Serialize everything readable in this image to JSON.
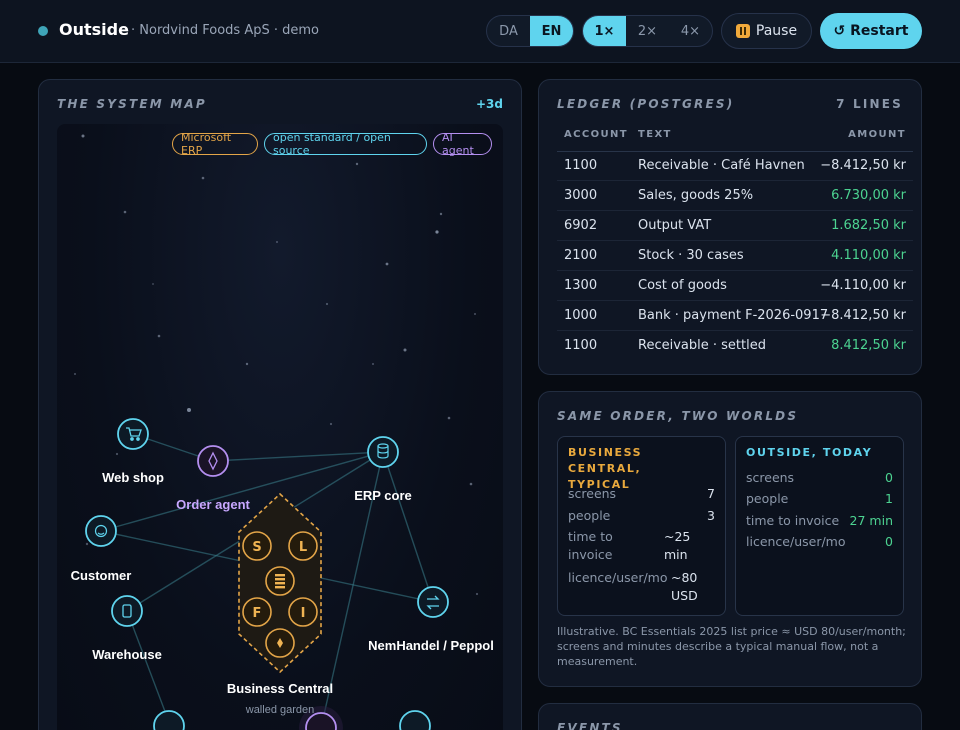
{
  "header": {
    "title": "Outside",
    "subtitle": "· Nordvind Foods ApS · demo",
    "lang_options": [
      "DA",
      "EN"
    ],
    "lang_selected": "EN",
    "speed_options": [
      "1×",
      "2×",
      "4×"
    ],
    "speed_selected": "1×",
    "pause_label": "Pause",
    "restart_label": "↺ Restart"
  },
  "map": {
    "title": "THE SYSTEM MAP",
    "badge": "+3d",
    "legend": {
      "microsoft": "Microsoft ERP",
      "open": "open standard / open source",
      "ai": "AI agent"
    },
    "nodes": {
      "webshop": "Web shop",
      "order_agent": "Order agent",
      "erp_core": "ERP core",
      "customer": "Customer",
      "warehouse": "Warehouse",
      "nemhandel": "NemHandel / Peppol",
      "bc": "Business Central",
      "bc_sub": "walled garden"
    },
    "hex_letters": [
      "S",
      "L",
      "F",
      "I"
    ]
  },
  "ledger": {
    "title": "LEDGER (POSTGRES)",
    "count": "7 LINES",
    "columns": [
      "ACCOUNT",
      "TEXT",
      "AMOUNT"
    ],
    "rows": [
      {
        "account": "1100",
        "text": "Receivable · Café Havnen",
        "amount": "−8.412,50 kr",
        "sign": "neg"
      },
      {
        "account": "3000",
        "text": "Sales, goods 25%",
        "amount": "6.730,00 kr",
        "sign": "pos"
      },
      {
        "account": "6902",
        "text": "Output VAT",
        "amount": "1.682,50 kr",
        "sign": "pos"
      },
      {
        "account": "2100",
        "text": "Stock · 30 cases",
        "amount": "4.110,00 kr",
        "sign": "pos"
      },
      {
        "account": "1300",
        "text": "Cost of goods",
        "amount": "−4.110,00 kr",
        "sign": "neg"
      },
      {
        "account": "1000",
        "text": "Bank · payment F-2026-0917",
        "amount": "−8.412,50 kr",
        "sign": "neg"
      },
      {
        "account": "1100",
        "text": "Receivable · settled",
        "amount": "8.412,50 kr",
        "sign": "pos"
      }
    ]
  },
  "compare": {
    "title": "SAME ORDER, TWO WORLDS",
    "bc": {
      "heading_1": "BUSINESS CENTRAL,",
      "heading_2": "TYPICAL",
      "screens_label": "screens",
      "screens": "7",
      "people_label": "people",
      "people": "3",
      "time_label_1": "time to",
      "time_label_2": "invoice",
      "time_1": "~25",
      "time_2": "min",
      "licence_label": "licence/user/mo",
      "licence_1": "~80",
      "licence_2": "USD"
    },
    "outside": {
      "heading": "OUTSIDE, TODAY",
      "screens_label": "screens",
      "screens": "0",
      "people_label": "people",
      "people": "1",
      "time_label": "time to invoice",
      "time": "27 min",
      "licence_label": "licence/user/mo",
      "licence": "0"
    },
    "note": "Illustrative. BC Essentials 2025 list price ≈ USD 80/user/month; screens and minutes describe a typical manual flow, not a measurement."
  },
  "events": {
    "title": "EVENTS"
  },
  "colors": {
    "accent": "#5fd4ee",
    "microsoft": "#e3a548",
    "ai": "#b48ff0",
    "positive": "#4cd391"
  }
}
